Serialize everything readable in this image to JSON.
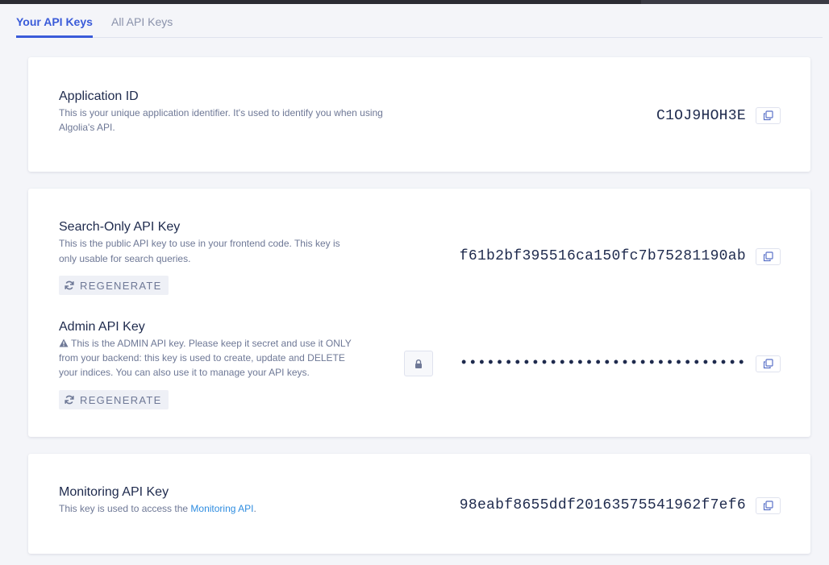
{
  "tabs": {
    "your_keys": "Your API Keys",
    "all_keys": "All API Keys"
  },
  "application": {
    "title": "Application ID",
    "desc_line1": "This is your unique application identifier. It's used to identify you when using",
    "desc_line2": "Algolia's API.",
    "value": "C1OJ9HOH3E"
  },
  "search_key": {
    "title": "Search-Only API Key",
    "desc_line1": "This is the public API key to use in your frontend code. This key is",
    "desc_line2": "only usable for search queries.",
    "value": "f61b2bf395516ca150fc7b75281190ab",
    "regenerate": "REGENERATE"
  },
  "admin_key": {
    "title": "Admin API Key",
    "desc_line1": "This is the ADMIN API key. Please keep it secret and use it ONLY",
    "desc_line2": "from your backend: this key is used to create, update and DELETE",
    "desc_line3": "your indices. You can also use it to manage your API keys.",
    "value": "••••••••••••••••••••••••••••••••",
    "regenerate": "REGENERATE"
  },
  "monitoring_key": {
    "title": "Monitoring API Key",
    "desc_prefix": "This key is used to access the ",
    "desc_link": "Monitoring API",
    "desc_suffix": ".",
    "value": "98eabf8655ddf20163575541962f7ef6"
  },
  "icons": {
    "copy": "copy-icon",
    "lock": "lock-icon",
    "refresh": "refresh-icon",
    "warning": "warning-icon"
  },
  "colors": {
    "accent": "#3a5bd9",
    "link": "#2f8de0",
    "text_dark": "#1e2a4d",
    "text_muted": "#6e7896"
  }
}
